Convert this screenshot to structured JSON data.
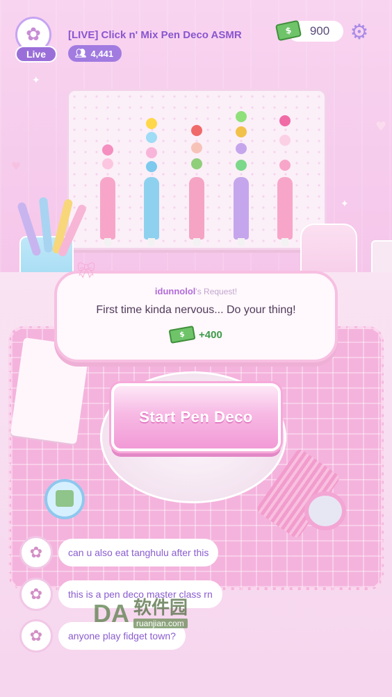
{
  "header": {
    "live_label": "Live",
    "stream_title": "[LIVE] Click n' Mix Pen Deco ASMR",
    "viewer_count": "4,441",
    "coins": "900",
    "icons": {
      "viewer": "users-icon",
      "money": "cash-icon",
      "settings": "gear-icon",
      "avatar": "bunny-avatar-icon"
    }
  },
  "request": {
    "requester": "idunnolol",
    "suffix": "'s Request!",
    "message": "First time kinda nervous... Do your thing!",
    "reward": "+400"
  },
  "start_button": {
    "label": "Start Pen Deco"
  },
  "chat": [
    {
      "text": "can u also eat tanghulu after this"
    },
    {
      "text": "this is a pen deco master class rn"
    },
    {
      "text": "anyone play fidget town?"
    }
  ],
  "watermark": {
    "logo": "DA",
    "cn": "软件园",
    "url": "ruanjian.com"
  },
  "colors": {
    "accent": "#9a6ed8",
    "pink": "#f29ad6",
    "money": "#3c9a48"
  }
}
